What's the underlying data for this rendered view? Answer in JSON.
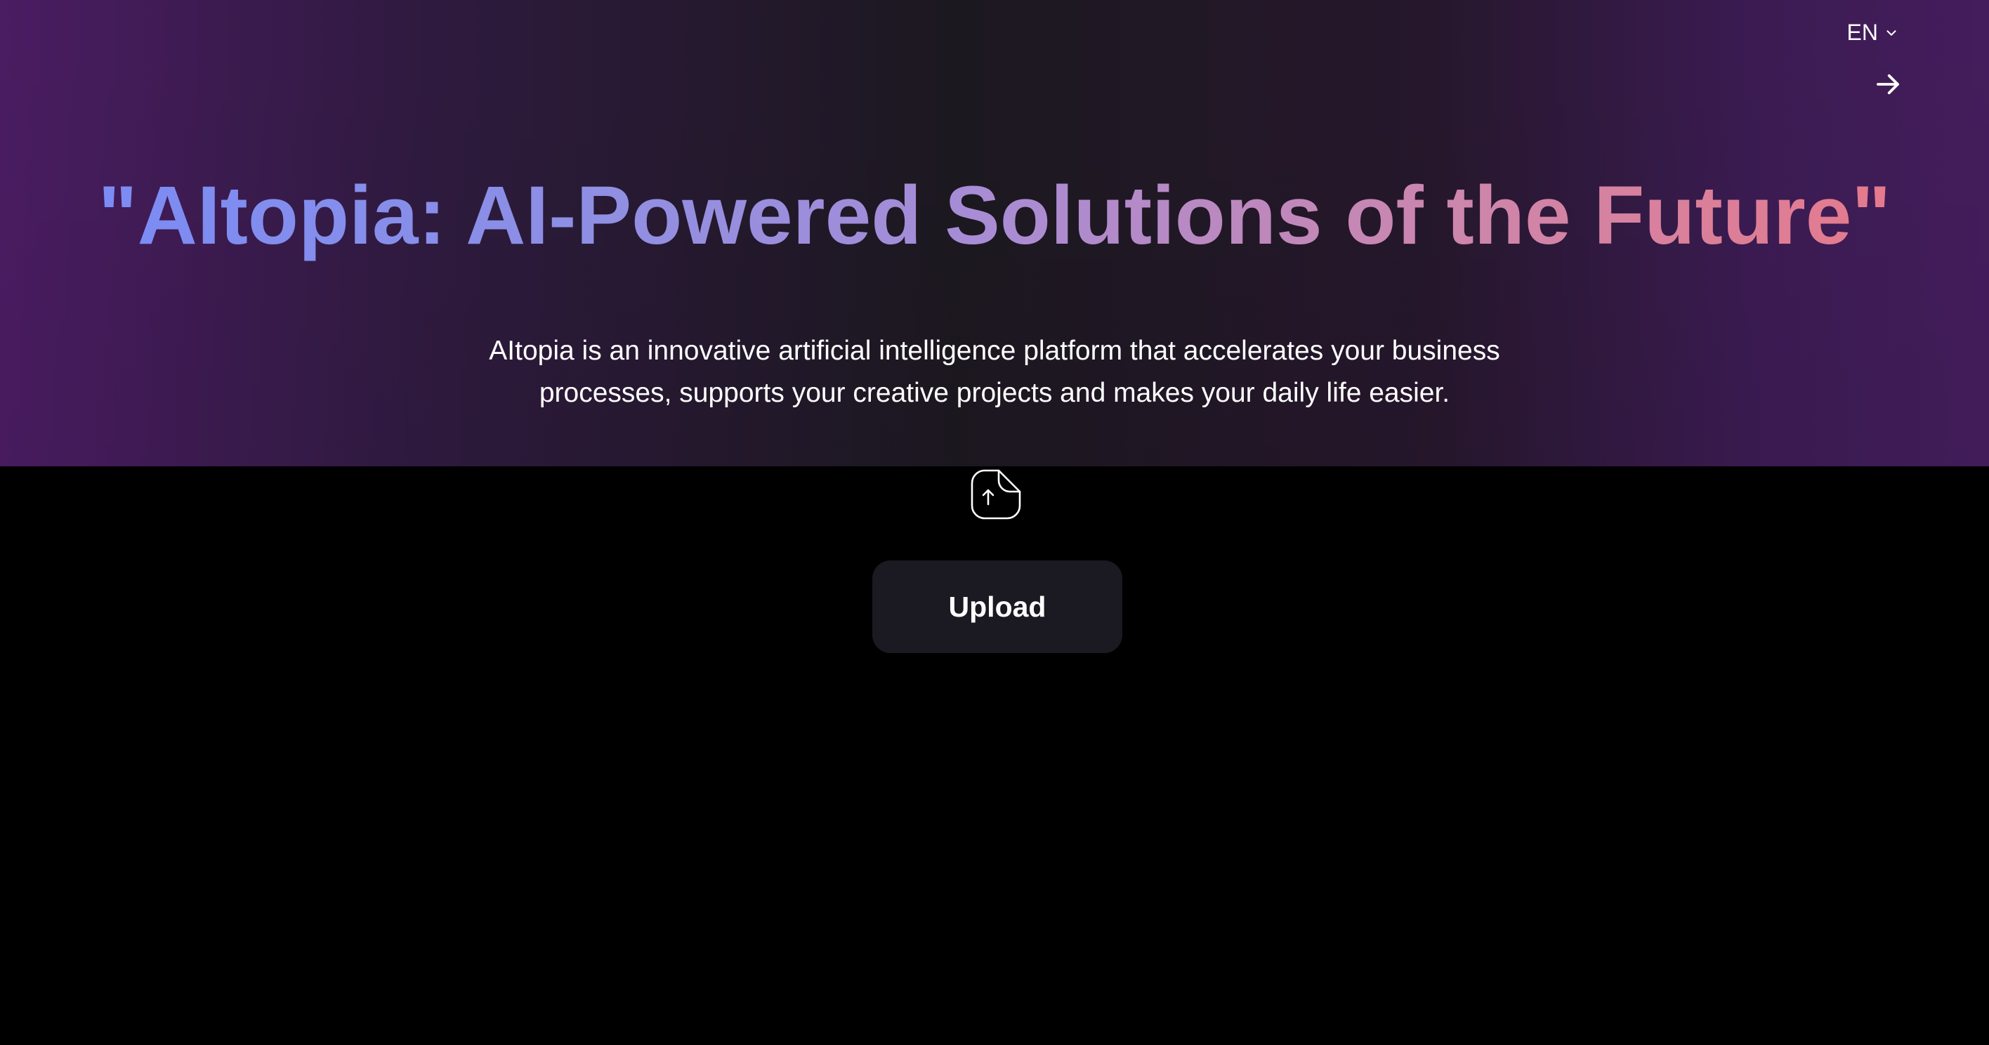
{
  "header": {
    "language": {
      "label": "EN",
      "icon": "chevron-down-icon"
    },
    "navigation": {
      "icon": "arrow-right-icon"
    }
  },
  "hero": {
    "title": "\"AItopia: AI-Powered Solutions of the Future\"",
    "description": "AItopia is an innovative artificial intelligence platform that accelerates your business processes, supports your creative projects and makes your daily life easier.",
    "colors": {
      "gradient_start": "#7b8cf4",
      "gradient_end": "#e57a8c",
      "background_left": "#4a1c62",
      "background_center": "#1c1820",
      "background_right": "#441d5c"
    }
  },
  "upload": {
    "icon": "file-upload-icon",
    "button_label": "Upload",
    "button_color": "#1b1a22"
  },
  "page": {
    "background": "#000000"
  }
}
